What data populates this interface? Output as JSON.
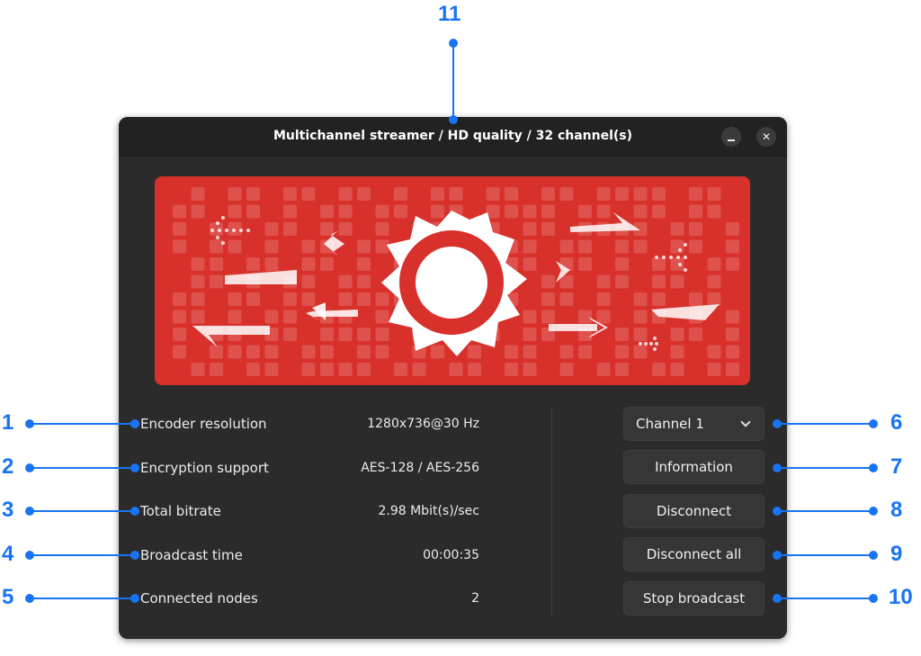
{
  "window": {
    "title": "Multichannel streamer / HD quality / 32 channel(s)",
    "minimize_icon": "minimize-icon",
    "close_icon": "close-icon",
    "close_glyph": "✕"
  },
  "banner": {
    "icon": "streamer-logo-icon",
    "color": "#d8302a"
  },
  "info": [
    {
      "label": "Encoder resolution",
      "value": "1280x736@30 Hz"
    },
    {
      "label": "Encryption support",
      "value": "AES-128 / AES-256"
    },
    {
      "label": "Total bitrate",
      "value": "2.98 Mbit(s)/sec"
    },
    {
      "label": "Broadcast time",
      "value": "00:00:35"
    },
    {
      "label": "Connected nodes",
      "value": "2"
    }
  ],
  "controls": {
    "channel_select": "Channel 1",
    "information": "Information",
    "disconnect": "Disconnect",
    "disconnect_all": "Disconnect all",
    "stop_broadcast": "Stop broadcast"
  },
  "callouts": [
    "1",
    "2",
    "3",
    "4",
    "5",
    "6",
    "7",
    "8",
    "9",
    "10",
    "11"
  ],
  "colors": {
    "callout": "#1874f3",
    "window_bg": "#2b2b2b",
    "titlebar_bg": "#222222"
  }
}
